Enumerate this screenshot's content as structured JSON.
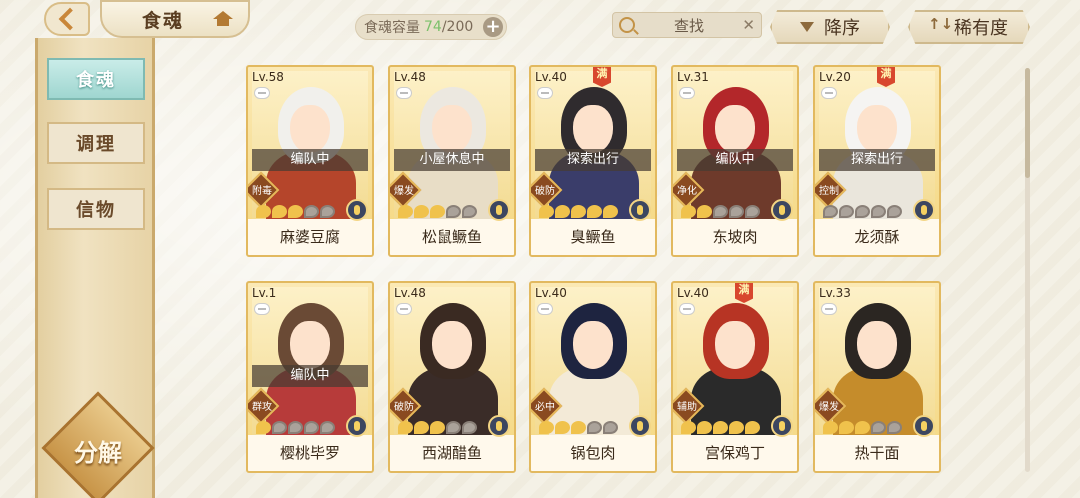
{
  "header": {
    "title": "食魂",
    "capacity_label": "食魂容量",
    "capacity_current": "74",
    "capacity_max": "/200",
    "search_placeholder": "查找",
    "sort_order_label": "降序",
    "sort_rarity_label": "稀有度"
  },
  "sidebar": {
    "items": [
      {
        "label": "食魂",
        "active": true
      },
      {
        "label": "调理",
        "active": false
      },
      {
        "label": "信物",
        "active": false
      }
    ],
    "decompose_label": "分解"
  },
  "colors": {
    "accent": "#c9873a",
    "active_tab": "#9fd6d0",
    "card_gold": "#f4d77f",
    "full_badge": "#d8472e"
  },
  "cards": [
    {
      "level": "Lv.58",
      "name": "麻婆豆腐",
      "status": "编队中",
      "role": "附毒",
      "full": false,
      "stars_on": 3,
      "hair": "#f1f0ec",
      "outfit": "#b5452b"
    },
    {
      "level": "Lv.48",
      "name": "松鼠鳜鱼",
      "status": "小屋休息中",
      "role": "爆发",
      "full": false,
      "stars_on": 3,
      "hair": "#ece8e0",
      "outfit": "#e8ddc6"
    },
    {
      "level": "Lv.40",
      "name": "臭鳜鱼",
      "status": "探索出行",
      "role": "破防",
      "full": true,
      "stars_on": 5,
      "hair": "#2f2b2e",
      "outfit": "#3a3d6a"
    },
    {
      "level": "Lv.31",
      "name": "东坡肉",
      "status": "编队中",
      "role": "净化",
      "full": false,
      "stars_on": 2,
      "hair": "#b3272a",
      "outfit": "#6e3a2b"
    },
    {
      "level": "Lv.20",
      "name": "龙须酥",
      "status": "探索出行",
      "role": "控制",
      "full": true,
      "stars_on": 0,
      "hair": "#f5f4f2",
      "outfit": "#eae6dc"
    },
    {
      "level": "Lv.1",
      "name": "樱桃毕罗",
      "status": "编队中",
      "role": "群攻",
      "full": false,
      "stars_on": 1,
      "hair": "#6a4a35",
      "outfit": "#b73b3a"
    },
    {
      "level": "Lv.48",
      "name": "西湖醋鱼",
      "status": "",
      "role": "破防",
      "full": false,
      "stars_on": 3,
      "hair": "#3a2a22",
      "outfit": "#3a2c28"
    },
    {
      "level": "Lv.40",
      "name": "锅包肉",
      "status": "",
      "role": "必中",
      "full": false,
      "stars_on": 3,
      "hair": "#1e2440",
      "outfit": "#f3ead7"
    },
    {
      "level": "Lv.40",
      "name": "宫保鸡丁",
      "status": "",
      "role": "辅助",
      "full": true,
      "stars_on": 5,
      "hair": "#b73424",
      "outfit": "#2a2a2a"
    },
    {
      "level": "Lv.33",
      "name": "热干面",
      "status": "",
      "role": "爆发",
      "full": false,
      "stars_on": 3,
      "hair": "#2b2622",
      "outfit": "#c58c2b"
    }
  ]
}
